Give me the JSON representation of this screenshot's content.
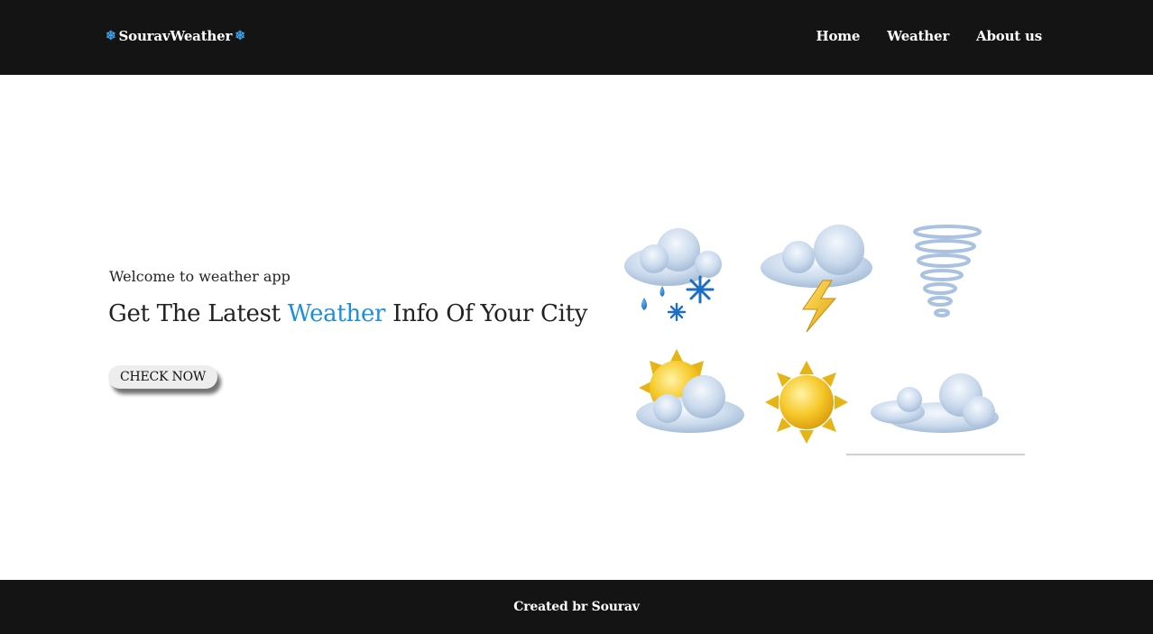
{
  "header": {
    "brand_name": "SouravWeather",
    "brand_icon": "snowflake-icon",
    "nav": [
      {
        "label": "Home"
      },
      {
        "label": "Weather"
      },
      {
        "label": "About us"
      }
    ]
  },
  "hero": {
    "welcome": "Welcome to weather app",
    "headline_before": "Get The Latest ",
    "headline_accent": "Weather",
    "headline_after": " Info Of Your City",
    "cta_label": "CHECK NOW",
    "weather_icons": [
      "snow-rain-cloud-icon",
      "thunderstorm-cloud-icon",
      "tornado-icon",
      "partly-sunny-icon",
      "sun-icon",
      "clouds-icon"
    ]
  },
  "footer": {
    "text": "Created br Sourav"
  },
  "colors": {
    "header_bg": "#141414",
    "accent": "#1b8fdc",
    "snowflake": "#3ea3e6"
  }
}
